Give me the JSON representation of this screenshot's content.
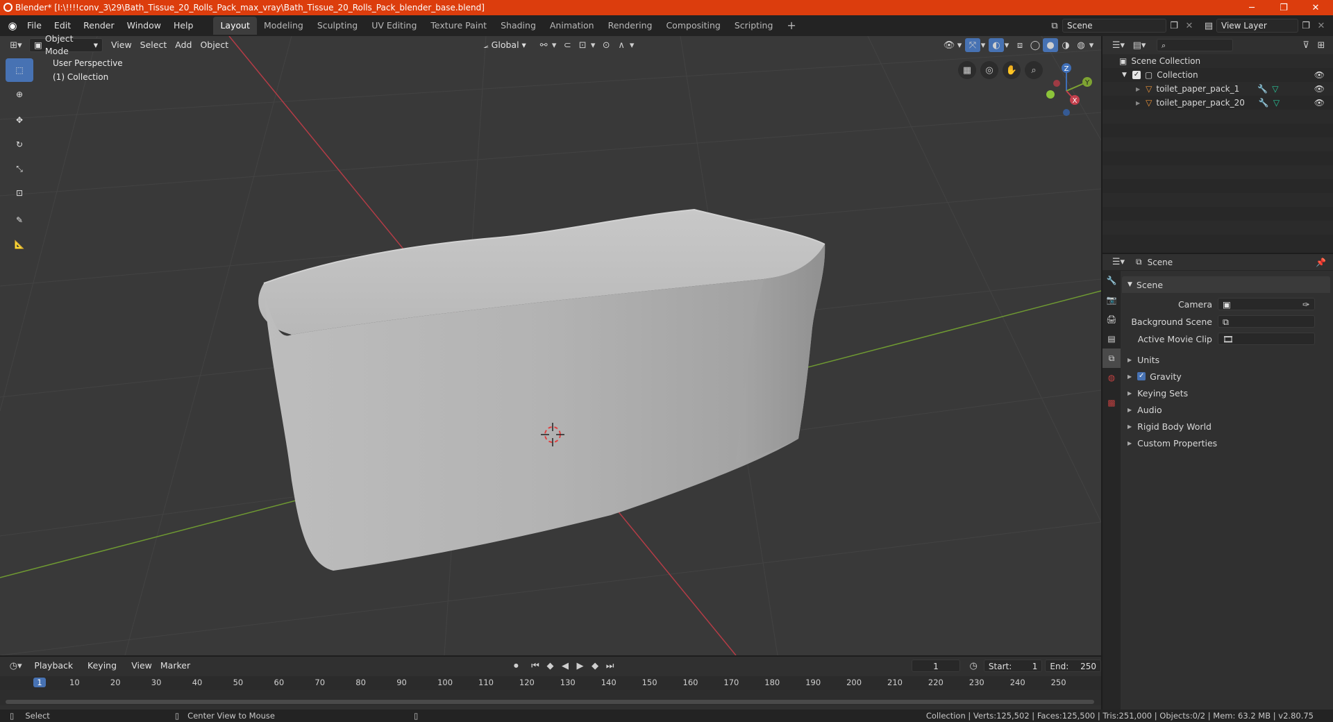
{
  "window": {
    "title": "Blender* [I:\\!!!!conv_3\\29\\Bath_Tissue_20_Rolls_Pack_max_vray\\Bath_Tissue_20_Rolls_Pack_blender_base.blend]",
    "minimize": "─",
    "maximize": "❐",
    "close": "✕"
  },
  "menu": [
    "File",
    "Edit",
    "Render",
    "Window",
    "Help"
  ],
  "workspaces": [
    "Layout",
    "Modeling",
    "Sculpting",
    "UV Editing",
    "Texture Paint",
    "Shading",
    "Animation",
    "Rendering",
    "Compositing",
    "Scripting"
  ],
  "workspace_add": "+",
  "scene_field": "Scene",
  "view_layer_field": "View Layer",
  "viewport": {
    "mode": "Object Mode",
    "header_menus": [
      "View",
      "Select",
      "Add",
      "Object"
    ],
    "orientation": "Global",
    "overlay_text_1": "User Perspective",
    "overlay_text_2": "(1) Collection",
    "gizmo": {
      "z": "Z",
      "y": "Y",
      "x": "X"
    }
  },
  "outliner": {
    "search_placeholder": "",
    "scene_collection": "Scene Collection",
    "collection": "Collection",
    "objects": [
      "toilet_paper_pack_1",
      "toilet_paper_pack_20"
    ]
  },
  "properties": {
    "header": "Scene",
    "panel_title": "Scene",
    "camera_label": "Camera",
    "background_scene_label": "Background Scene",
    "active_movie_clip_label": "Active Movie Clip",
    "subpanels": [
      "Units",
      "Gravity",
      "Keying Sets",
      "Audio",
      "Rigid Body World",
      "Custom Properties"
    ],
    "gravity_checked": true
  },
  "timeline": {
    "menus": [
      "Playback",
      "Keying",
      "View",
      "Marker"
    ],
    "current_frame": "1",
    "start_label": "Start:",
    "start_value": "1",
    "end_label": "End:",
    "end_value": "250",
    "ruler": [
      "1",
      "10",
      "20",
      "30",
      "40",
      "50",
      "60",
      "70",
      "80",
      "90",
      "100",
      "110",
      "120",
      "130",
      "140",
      "150",
      "160",
      "170",
      "180",
      "190",
      "200",
      "210",
      "220",
      "230",
      "240",
      "250"
    ]
  },
  "status": {
    "left_1": "Select",
    "left_2": "Center View to Mouse",
    "right": "Collection | Verts:125,502 | Faces:125,500 | Tris:251,000 | Objects:0/2 | Mem: 63.2 MB | v2.80.75"
  },
  "colors": {
    "title_bar": "#dc3d0d",
    "viewport_bg": "#393939",
    "active_blue": "#4772b3",
    "x_axis": "#b43c46",
    "y_axis": "#6f9a32"
  }
}
